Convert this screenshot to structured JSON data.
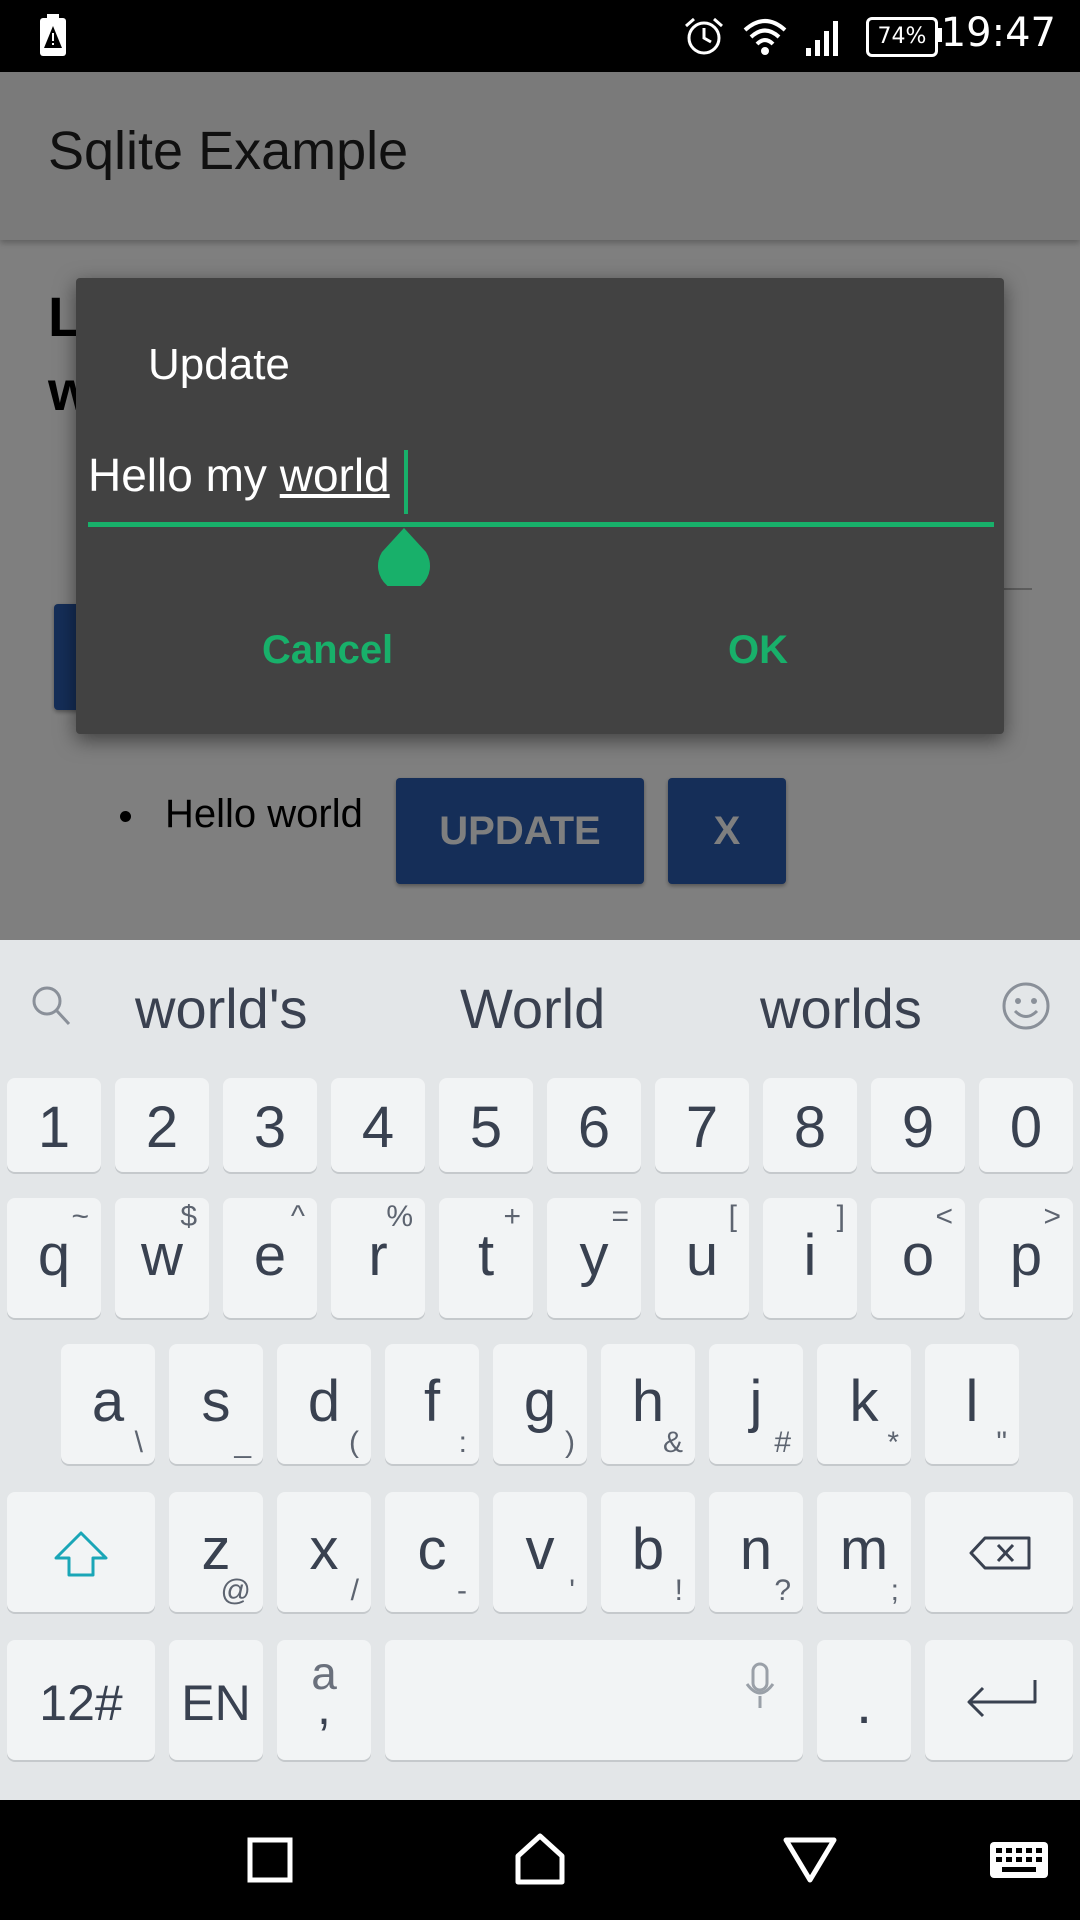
{
  "status_bar": {
    "time": "19:47",
    "battery": "74%",
    "icons": [
      "alert-battery-icon",
      "alarm-icon",
      "wifi-icon",
      "signal-icon"
    ]
  },
  "app": {
    "title": "Sqlite Example",
    "heading_partial": [
      "L",
      "w"
    ],
    "list_item_text": "Hello world",
    "update_button": "UPDATE",
    "delete_button": "X",
    "accent_color": "#2a5db0"
  },
  "dialog": {
    "title": "Update",
    "input_before": "Hello my ",
    "input_composing": "world",
    "cancel_label": "Cancel",
    "ok_label": "OK",
    "accent_color": "#18b06a"
  },
  "keyboard": {
    "suggestions": [
      "world's",
      "World",
      "worlds"
    ],
    "number_row": [
      "1",
      "2",
      "3",
      "4",
      "5",
      "6",
      "7",
      "8",
      "9",
      "0"
    ],
    "row_q": [
      [
        "q",
        "~"
      ],
      [
        "w",
        "$"
      ],
      [
        "e",
        "^"
      ],
      [
        "r",
        "%"
      ],
      [
        "t",
        "+"
      ],
      [
        "y",
        "="
      ],
      [
        "u",
        "["
      ],
      [
        "i",
        "]"
      ],
      [
        "o",
        "<"
      ],
      [
        "p",
        ">"
      ]
    ],
    "row_a": [
      [
        "a",
        "\\"
      ],
      [
        "s",
        "_"
      ],
      [
        "d",
        "("
      ],
      [
        "f",
        ":"
      ],
      [
        "g",
        ")"
      ],
      [
        "h",
        "&"
      ],
      [
        "j",
        "#"
      ],
      [
        "k",
        "*"
      ],
      [
        "l",
        "\""
      ]
    ],
    "row_z": [
      [
        "z",
        "@"
      ],
      [
        "x",
        "/"
      ],
      [
        "c",
        "-"
      ],
      [
        "v",
        "'"
      ],
      [
        "b",
        "!"
      ],
      [
        "n",
        "?"
      ],
      [
        "m",
        ";"
      ]
    ],
    "symbols_key": "12#",
    "language_key": "EN",
    "punct_key_top": "a",
    "punct_key_bottom": ",",
    "period_key": "."
  }
}
